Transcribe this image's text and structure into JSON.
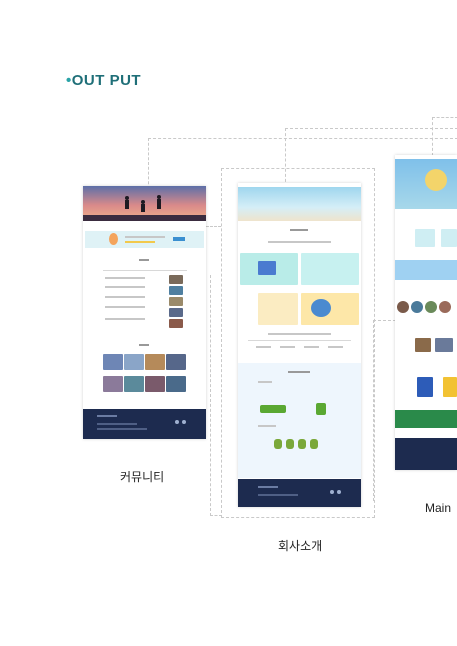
{
  "header": {
    "logo_dot": "•",
    "logo_text": "OUT PUT"
  },
  "pages": [
    {
      "label": "커뮤니티"
    },
    {
      "label": "회사소개"
    },
    {
      "label": "Main"
    }
  ],
  "colors": {
    "brand": "#1f6f78",
    "footer": "#1d2b4f",
    "sky": "#a7d8ea"
  }
}
